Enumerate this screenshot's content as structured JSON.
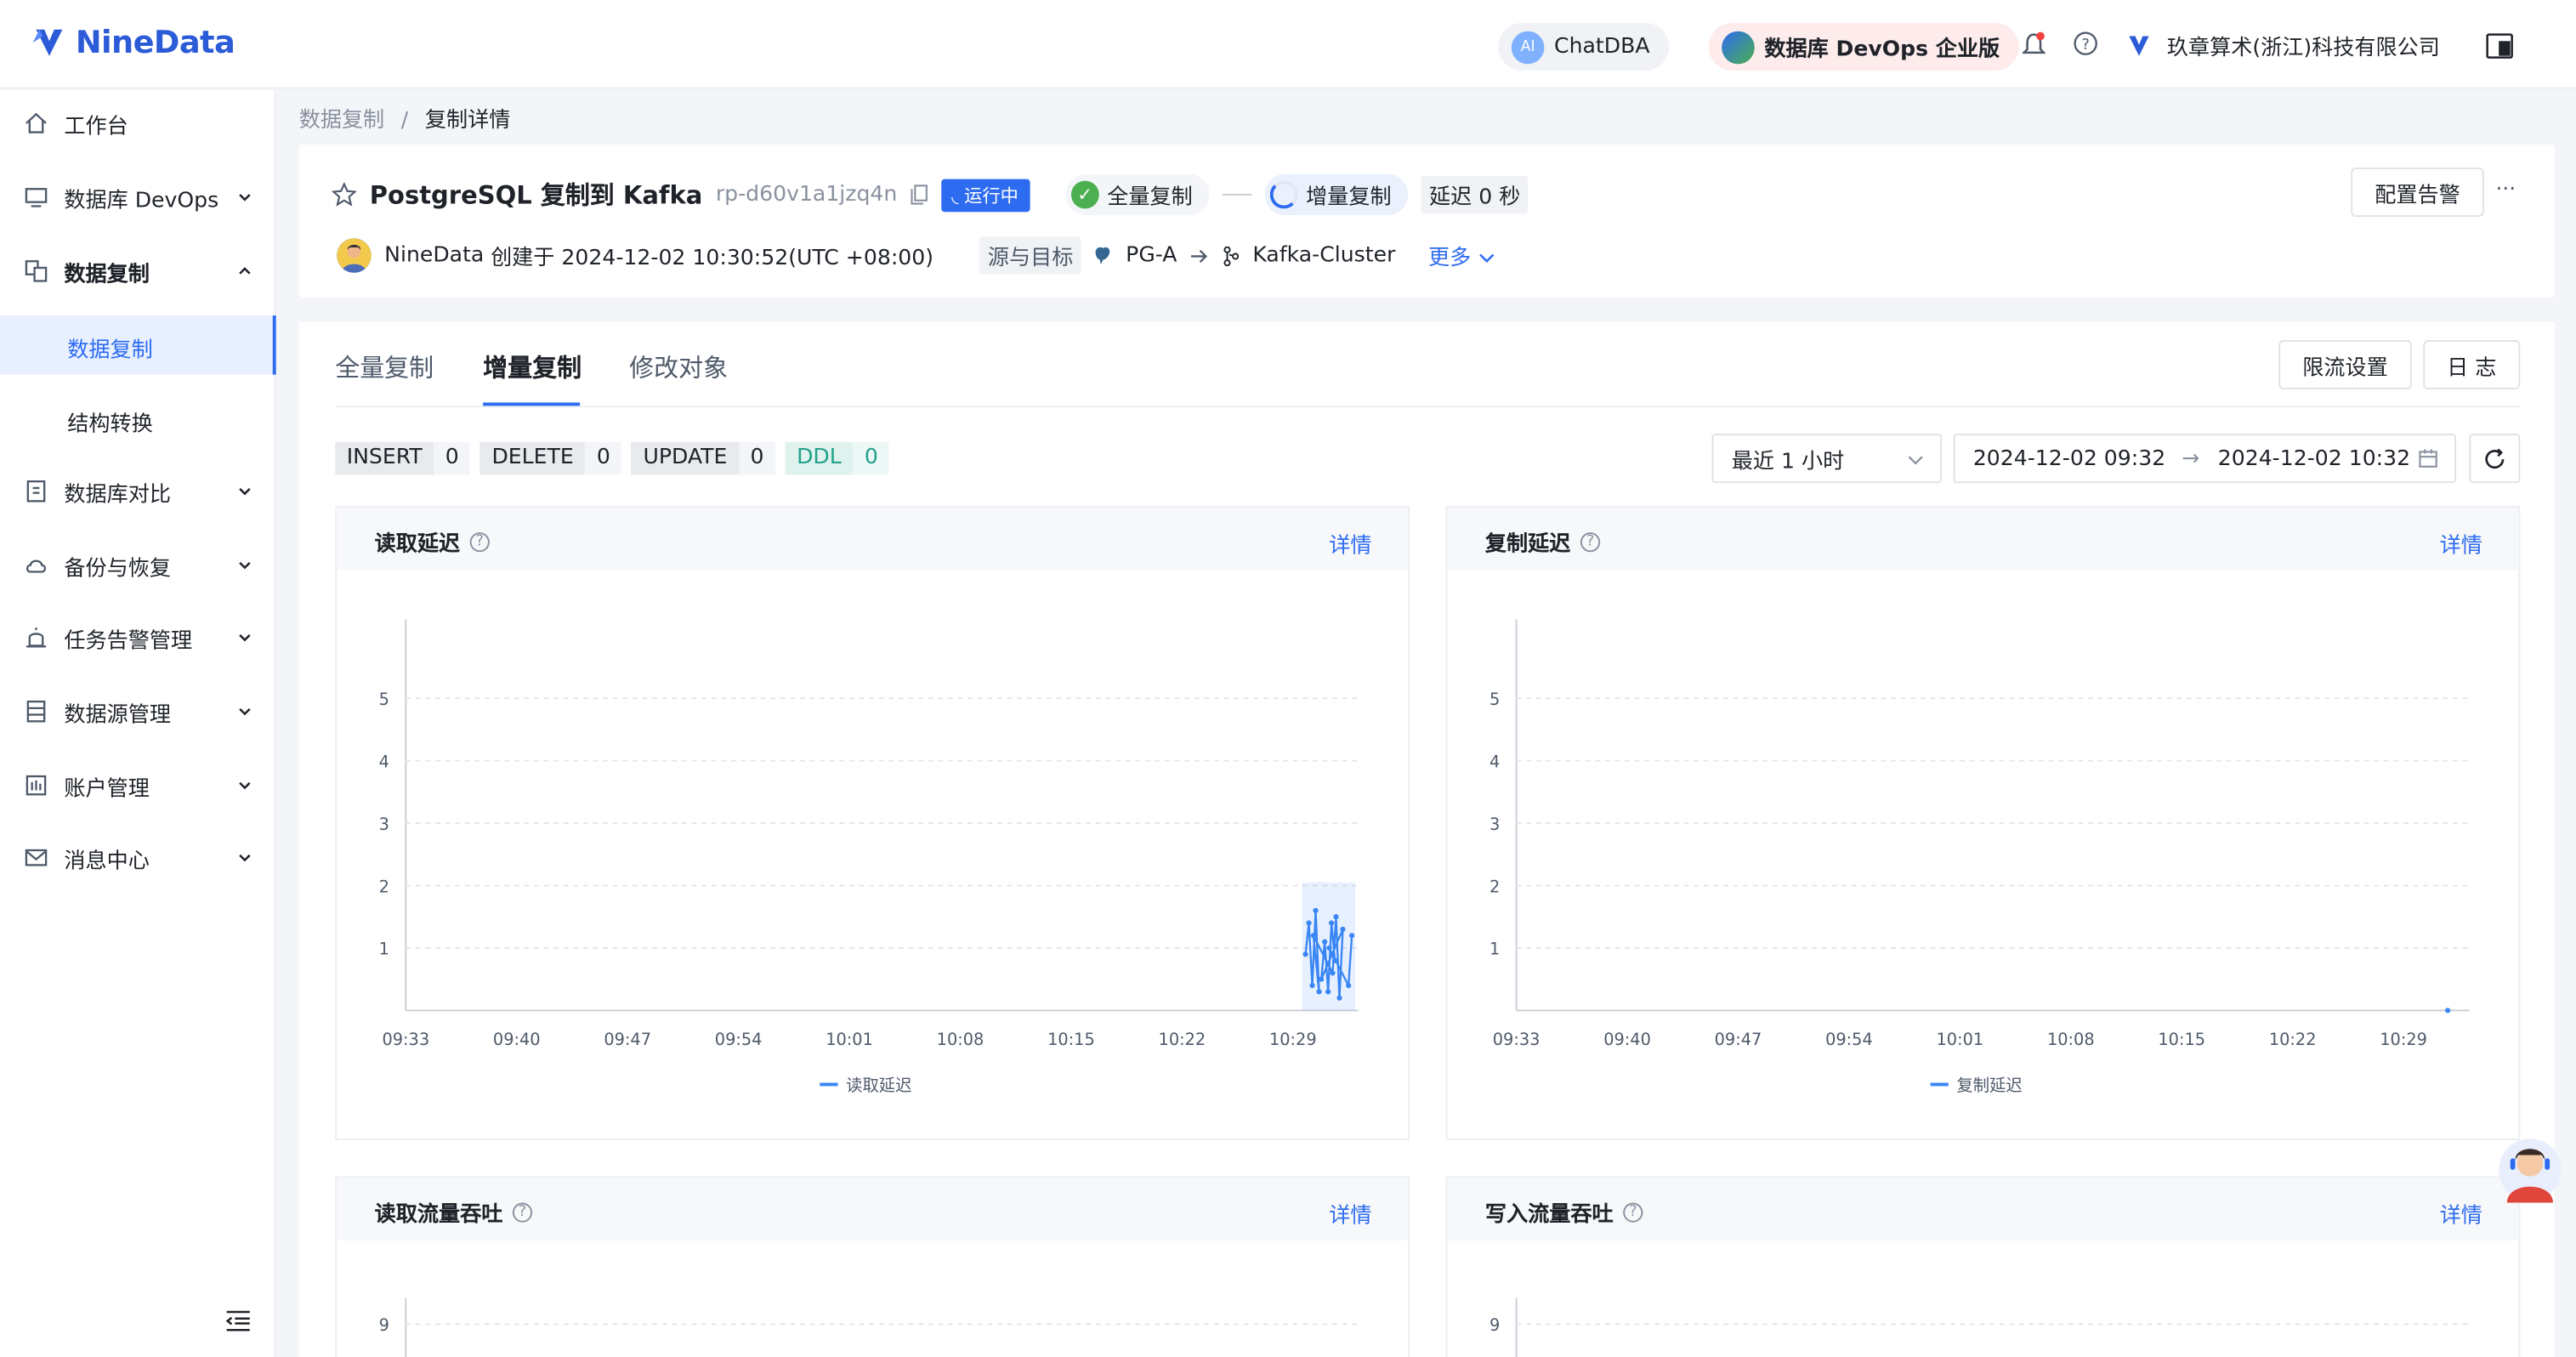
{
  "brand": {
    "name": "NineData",
    "accent": "#2d6bf0"
  },
  "header": {
    "chatdba": "ChatDBA",
    "edition": "数据库 DevOps 企业版",
    "company": "玖章算术(浙江)科技有限公司"
  },
  "sidebar": {
    "items": [
      {
        "label": "工作台",
        "icon": "home-icon"
      },
      {
        "label": "数据库 DevOps",
        "icon": "monitor-icon"
      },
      {
        "label": "数据复制",
        "icon": "replicate-icon"
      },
      {
        "label": "数据复制"
      },
      {
        "label": "结构转换"
      },
      {
        "label": "数据库对比",
        "icon": "compare-icon"
      },
      {
        "label": "备份与恢复",
        "icon": "cloud-icon"
      },
      {
        "label": "任务告警管理",
        "icon": "alarm-icon"
      },
      {
        "label": "数据源管理",
        "icon": "datasource-icon"
      },
      {
        "label": "账户管理",
        "icon": "account-icon"
      },
      {
        "label": "消息中心",
        "icon": "mail-icon"
      }
    ]
  },
  "breadcrumb": {
    "parent": "数据复制",
    "sep": "/",
    "current": "复制详情"
  },
  "task": {
    "title": "PostgreSQL 复制到 Kafka",
    "id": "rp-d60v1a1jzq4n",
    "status": "运行中",
    "step_full": "全量复制",
    "step_inc": "增量复制",
    "delay_label": "延迟",
    "delay_value": "0 秒",
    "creator": "NineData",
    "created": "创建于 2024-12-02 10:30:52(UTC +08:00)",
    "src_tgt_label": "源与目标",
    "source": "PG-A",
    "target": "Kafka-Cluster",
    "more": "更多",
    "alert_btn": "配置告警",
    "ellipsis": "···"
  },
  "tabs": [
    {
      "label": "全量复制"
    },
    {
      "label": "增量复制"
    },
    {
      "label": "修改对象"
    }
  ],
  "actions": {
    "throttle": "限流设置",
    "log": "日 志"
  },
  "counters": [
    {
      "key": "INSERT",
      "value": "0"
    },
    {
      "key": "DELETE",
      "value": "0"
    },
    {
      "key": "UPDATE",
      "value": "0"
    },
    {
      "key": "DDL",
      "value": "0"
    }
  ],
  "filter": {
    "range_select": "最近 1 小时",
    "start": "2024-12-02 09:32",
    "arrow": "→",
    "end": "2024-12-02 10:32"
  },
  "charts": [
    {
      "title": "读取延迟",
      "detail": "详情",
      "legend": "读取延迟"
    },
    {
      "title": "复制延迟",
      "detail": "详情",
      "legend": "复制延迟"
    },
    {
      "title": "读取流量吞吐",
      "detail": "详情"
    },
    {
      "title": "写入流量吞吐",
      "detail": "详情"
    }
  ],
  "chart_data": [
    {
      "type": "line",
      "title": "读取延迟",
      "x": [
        "09:33",
        "09:40",
        "09:47",
        "09:54",
        "10:01",
        "10:08",
        "10:15",
        "10:22",
        "10:29"
      ],
      "yticks": [
        1,
        2,
        3,
        4,
        5
      ],
      "ylim": [
        0,
        6
      ],
      "series": [
        {
          "name": "读取延迟",
          "color": "#3a86f5",
          "points": [
            [
              10.3,
              0.9
            ],
            [
              10.301,
              1.4
            ],
            [
              10.302,
              0.4
            ],
            [
              10.303,
              1.6
            ],
            [
              10.304,
              0.3
            ],
            [
              10.305,
              1.2
            ],
            [
              10.306,
              0.6
            ],
            [
              10.307,
              1.5
            ],
            [
              10.308,
              0.2
            ],
            [
              10.309,
              1.3
            ],
            [
              10.31,
              0.5
            ],
            [
              10.311,
              1.1
            ],
            [
              10.312,
              0.3
            ],
            [
              10.313,
              1.4
            ],
            [
              10.314,
              0.8
            ],
            [
              10.315,
              1.0
            ],
            [
              10.316,
              0.4
            ],
            [
              10.317,
              1.2
            ]
          ]
        }
      ]
    },
    {
      "type": "line",
      "title": "复制延迟",
      "x": [
        "09:33",
        "09:40",
        "09:47",
        "09:54",
        "10:01",
        "10:08",
        "10:15",
        "10:22",
        "10:29"
      ],
      "yticks": [
        1,
        2,
        3,
        4,
        5
      ],
      "ylim": [
        0,
        6
      ],
      "series": [
        {
          "name": "复制延迟",
          "color": "#3a86f5",
          "points": [
            [
              10.32,
              0
            ]
          ]
        }
      ]
    },
    {
      "type": "line",
      "title": "读取流量吞吐",
      "yticks": [
        9
      ]
    },
    {
      "type": "line",
      "title": "写入流量吞吐",
      "yticks": [
        9
      ]
    }
  ]
}
